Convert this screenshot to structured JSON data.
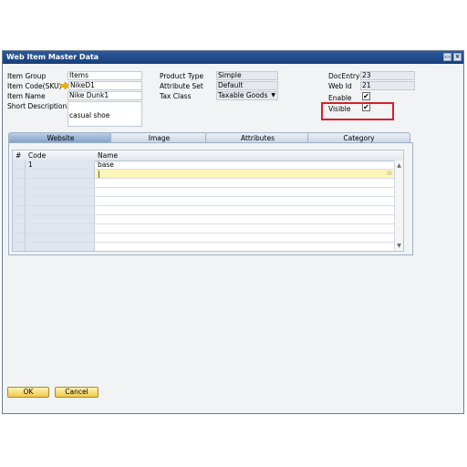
{
  "window": {
    "title": "Web Item Master Data"
  },
  "form": {
    "item_group_label": "Item Group",
    "item_group_value": "Items",
    "item_code_label": "Item Code(SKU)",
    "item_code_value": "NikeD1",
    "item_name_label": "Item Name",
    "item_name_value": "Nike Dunk1",
    "short_desc_label": "Short Description",
    "short_desc_value": "casual shoe",
    "product_type_label": "Product Type",
    "product_type_value": "Simple",
    "attribute_set_label": "Attribute Set",
    "attribute_set_value": "Default",
    "tax_class_label": "Tax Class",
    "tax_class_value": "Taxable Goods",
    "docentry_label": "DocEntry",
    "docentry_value": "23",
    "webid_label": "Web Id",
    "webid_value": "21",
    "enable_label": "Enable",
    "enable_checked": true,
    "visible_label": "Visible",
    "visible_checked": true,
    "check_mark": "✔"
  },
  "tabs": [
    "Website",
    "Image",
    "Attributes",
    "Category"
  ],
  "active_tab": "Website",
  "grid": {
    "columns": [
      "#",
      "Code",
      "Name"
    ],
    "rows": [
      {
        "code": "1",
        "name": "base"
      },
      {
        "code": "",
        "name": "|"
      }
    ]
  },
  "buttons": {
    "ok": "OK",
    "cancel": "Cancel"
  },
  "colors": {
    "title_bar": "#1f4c8c",
    "highlight_row": "#fff5b8",
    "annotation_box": "#d81e2a",
    "button": "#f0c84a"
  }
}
